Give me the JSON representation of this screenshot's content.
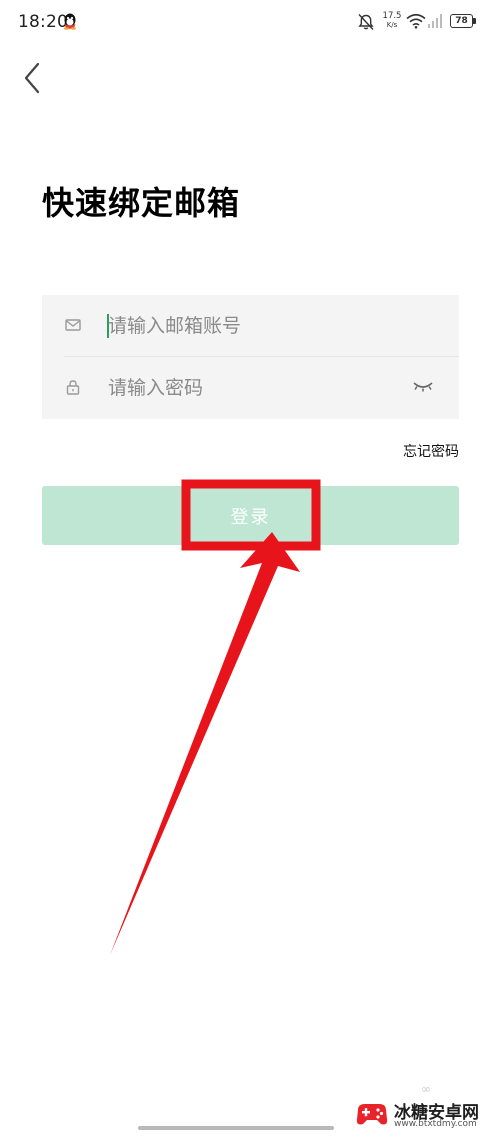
{
  "status_bar": {
    "time": "18:20",
    "net_speed_value": "17.5",
    "net_speed_unit": "K/s",
    "battery": "78",
    "icons": [
      "qq-icon",
      "bell-off-icon",
      "wifi-icon",
      "signal-icon",
      "battery-icon"
    ]
  },
  "nav": {
    "back_icon": "chevron-left-icon"
  },
  "page": {
    "title": "快速绑定邮箱"
  },
  "form": {
    "email": {
      "icon": "mail-icon",
      "value": "",
      "placeholder": "请输入邮箱账号"
    },
    "password": {
      "icon": "lock-icon",
      "value": "",
      "placeholder": "请输入密码",
      "toggle_icon": "eye-closed-icon"
    },
    "forgot_label": "忘记密码",
    "login_label": "登录"
  },
  "annotation": {
    "color": "#e8141b",
    "type": "highlight-box-with-arrow"
  },
  "watermark": {
    "name": "冰糖安卓网",
    "url": "www.btxtdmy.com"
  },
  "colors": {
    "accent_green": "#2e9b62",
    "login_button_bg": "#bfe6d2",
    "form_bg": "#f4f4f4",
    "annotation_red": "#e8141b"
  }
}
